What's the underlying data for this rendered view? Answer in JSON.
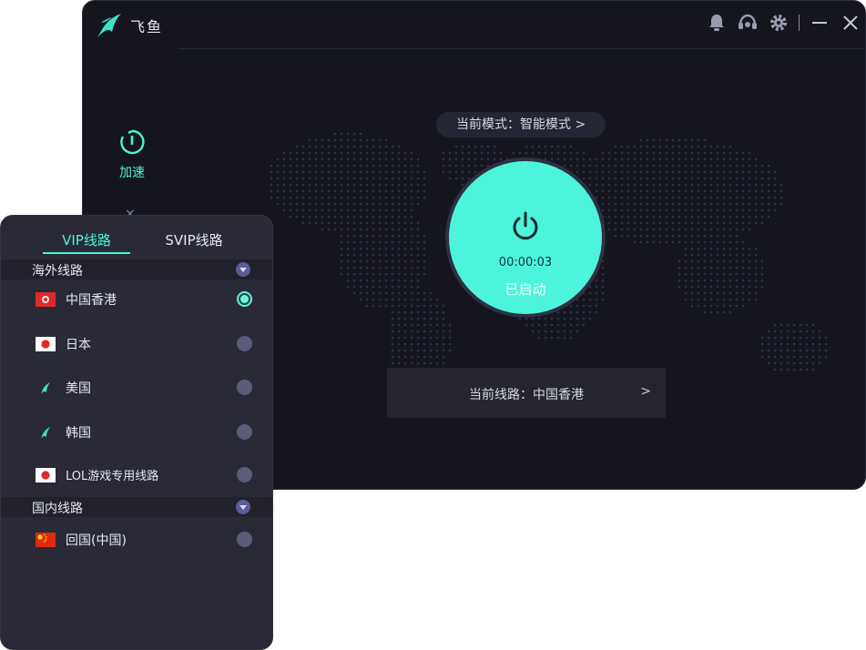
{
  "app": {
    "name": "飞鱼",
    "colors": {
      "accent": "#4cf5da",
      "window_bg": "#15151e",
      "panel_bg": "#292a36"
    },
    "icons": [
      "bell-icon",
      "headset-icon",
      "gear-icon",
      "minimize-icon",
      "close-icon"
    ]
  },
  "sidebar": {
    "accelerate_label": "加速",
    "more_glyph": "×"
  },
  "main": {
    "mode_label": "当前模式：智能模式 >",
    "timer": "00:00:03",
    "status": "已启动",
    "route_label": "当前线路：中国香港",
    "route_arrow": ">"
  },
  "route_panel": {
    "tabs": [
      "VIP线路",
      "SVIP线路"
    ],
    "active_tab": "VIP线路",
    "sections": [
      {
        "title": "海外线路",
        "items": [
          {
            "name": "中国香港",
            "flag": "hk-flag",
            "selected": true
          },
          {
            "name": "日本",
            "flag": "jp-flag",
            "selected": false
          },
          {
            "name": "美国",
            "flag": "fish-logo-icon",
            "selected": false
          },
          {
            "name": "韩国",
            "flag": "fish-logo-icon",
            "selected": false
          },
          {
            "name": "LOL游戏专用线路",
            "flag": "jp-flag",
            "selected": false
          }
        ]
      },
      {
        "title": "国内线路",
        "items": [
          {
            "name": "回国(中国)",
            "flag": "cn-flag",
            "selected": false
          }
        ]
      }
    ]
  }
}
